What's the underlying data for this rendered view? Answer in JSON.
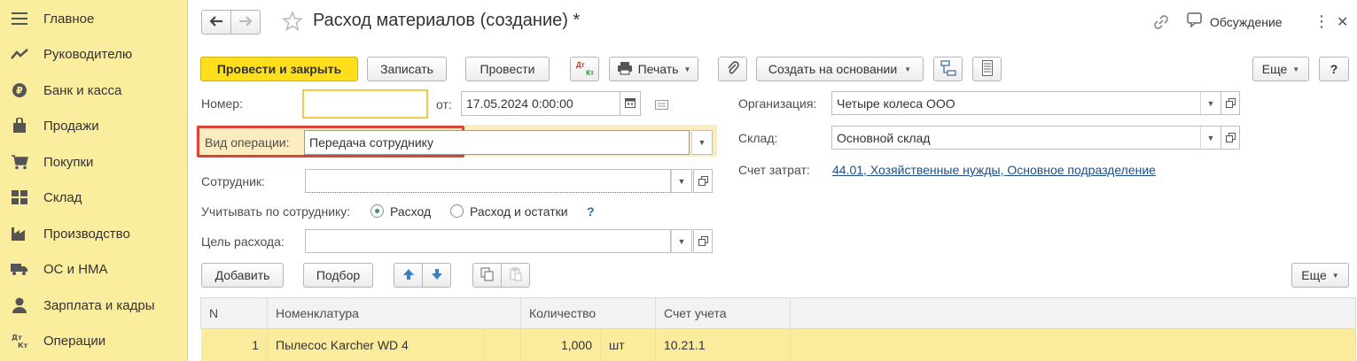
{
  "sidebar": {
    "items": [
      {
        "label": "Главное",
        "icon": "menu-icon"
      },
      {
        "label": "Руководителю",
        "icon": "trend-icon"
      },
      {
        "label": "Банк и касса",
        "icon": "ruble-coin-icon"
      },
      {
        "label": "Продажи",
        "icon": "shopping-bag-icon"
      },
      {
        "label": "Покупки",
        "icon": "cart-icon"
      },
      {
        "label": "Склад",
        "icon": "warehouse-icon"
      },
      {
        "label": "Производство",
        "icon": "factory-icon"
      },
      {
        "label": "ОС и НМА",
        "icon": "truck-icon"
      },
      {
        "label": "Зарплата и кадры",
        "icon": "person-icon"
      },
      {
        "label": "Операции",
        "icon": "dt-kt-icon"
      }
    ]
  },
  "header": {
    "title": "Расход материалов (создание) *",
    "discussion_label": "Обсуждение",
    "more_glyph": "⋮",
    "close_glyph": "✕"
  },
  "toolbar": {
    "post_and_close": "Провести и закрыть",
    "save": "Записать",
    "post": "Провести",
    "dtkt_top": "Дт",
    "dtkt_bottom": "Кт",
    "print": "Печать",
    "create_based_on": "Создать на основании",
    "more": "Еще",
    "help": "?"
  },
  "form": {
    "number_label": "Номер:",
    "number_value": "",
    "date_from_label": "от:",
    "date_value": "17.05.2024  0:00:00",
    "operation_type_label": "Вид операции:",
    "operation_type_value": "Передача сотруднику",
    "employee_label": "Сотрудник:",
    "employee_value": "",
    "account_by_employee_label": "Учитывать по сотруднику:",
    "radio_expense": "Расход",
    "radio_expense_and_balance": "Расход и остатки",
    "radio_selected": "Расход",
    "hint": "?",
    "purpose_label": "Цель расхода:",
    "purpose_value": "",
    "organization_label": "Организация:",
    "organization_value": "Четыре колеса ООО",
    "warehouse_label": "Склад:",
    "warehouse_value": "Основной склад",
    "cost_account_label": "Счет затрат:",
    "cost_account_value": "44.01, Хозяйственные нужды, Основное подразделение"
  },
  "table_toolbar": {
    "add": "Добавить",
    "pick": "Подбор",
    "more": "Еще"
  },
  "table": {
    "columns": [
      "N",
      "Номенклатура",
      "Количество",
      "Счет учета"
    ],
    "rows": [
      {
        "n": "1",
        "item": "Пылесос Karcher WD 4",
        "qty": "1,000",
        "unit": "шт",
        "account": "10.21.1"
      }
    ]
  },
  "colors": {
    "sidebar_bg": "#fbed9e",
    "primary_button": "#ffdf1c",
    "highlight_frame": "#d9453a",
    "selected_row": "#fbec9d",
    "link": "#1c4e86"
  }
}
